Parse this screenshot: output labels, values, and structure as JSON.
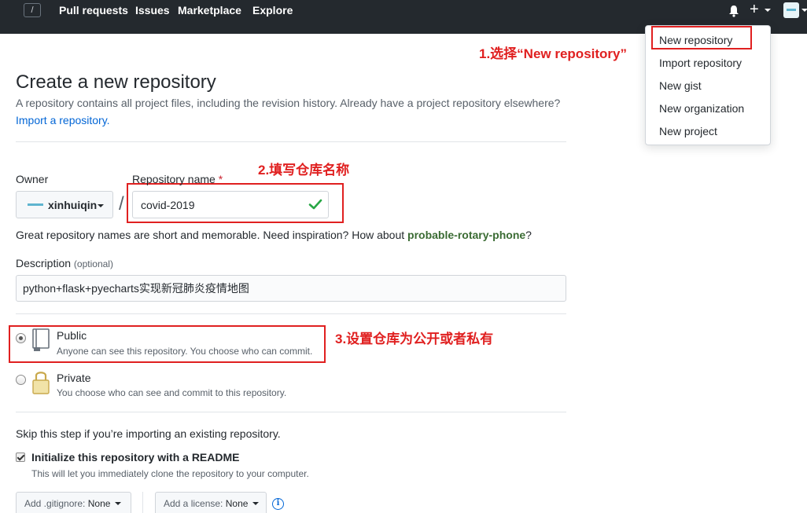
{
  "header": {
    "slash": "/",
    "nav": [
      "Pull requests",
      "Issues",
      "Marketplace",
      "Explore"
    ],
    "plus": "+"
  },
  "dropdown": {
    "items": [
      "New repository",
      "Import repository",
      "New gist",
      "New organization",
      "New project"
    ]
  },
  "annotations": {
    "step1": "1.选择“New repository”",
    "step2": "2.填写仓库名称",
    "step3": "3.设置仓库为公开或者私有"
  },
  "main": {
    "title": "Create a new repository",
    "subtitle": "A repository contains all project files, including the revision history. Already have a project repository elsewhere?",
    "import_link": "Import a repository.",
    "owner_label": "Owner",
    "owner_name": "xinhuiqin",
    "repo_label": "Repository name",
    "required_mark": "*",
    "slash": "/",
    "repo_name": "covid-2019",
    "hint_prefix": "Great repository names are short and memorable. Need inspiration? How about ",
    "hint_suggestion": "probable-rotary-phone",
    "hint_suffix": "?",
    "desc_label": "Description",
    "desc_optional": "(optional)",
    "description": "python+flask+pyecharts实现新冠肺炎疫情地图",
    "public_title": "Public",
    "public_note": "Anyone can see this repository. You choose who can commit.",
    "private_title": "Private",
    "private_note": "You choose who can see and commit to this repository.",
    "visibility_selected": "Public",
    "skip_text": "Skip this step if you’re importing an existing repository.",
    "init_label": "Initialize this repository with a README",
    "init_checked": true,
    "init_note": "This will let you immediately clone the repository to your computer.",
    "gitignore_label": "Add .gitignore:",
    "gitignore_value": "None",
    "license_label": "Add a license:",
    "license_value": "None",
    "info_glyph": "i"
  },
  "colors": {
    "header_bg": "#24292e",
    "annotation_red": "#e02020",
    "link_blue": "#0366d6",
    "check_green": "#28a745"
  }
}
